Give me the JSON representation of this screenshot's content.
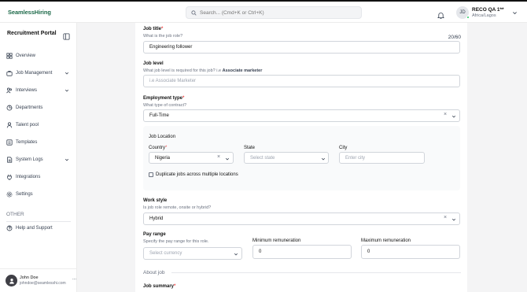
{
  "brand": {
    "logo": "SeamlessHiring"
  },
  "search": {
    "placeholder": "Search... (Cmd+K or Ctrl+K)"
  },
  "user": {
    "initials": "JD",
    "name": "RECO QA 1**",
    "location": "Africa/Lagos"
  },
  "sidebar": {
    "title": "Recruitment Portal",
    "items": [
      {
        "label": "Overview",
        "icon": "grid-icon"
      },
      {
        "label": "Job Management",
        "icon": "briefcase-icon"
      },
      {
        "label": "Interviews",
        "icon": "people-icon"
      },
      {
        "label": "Departments",
        "icon": "building-icon"
      },
      {
        "label": "Talent pool",
        "icon": "users-icon"
      },
      {
        "label": "Templates",
        "icon": "template-icon"
      },
      {
        "label": "System Logs",
        "icon": "log-icon"
      },
      {
        "label": "Integrations",
        "icon": "plug-icon"
      },
      {
        "label": "Settings",
        "icon": "gear-icon"
      }
    ],
    "other_title": "OTHER",
    "other_items": [
      {
        "label": "Help and Support",
        "icon": "help-icon"
      }
    ],
    "footer": {
      "name": "John Doe",
      "email": "johndoe@seamlesshi.com",
      "more": "..."
    }
  },
  "form": {
    "job_title": {
      "label": "Job title",
      "hint": "What is the job role?",
      "value": "Engineering follower",
      "counter": "20/60"
    },
    "job_level": {
      "label": "Job level",
      "hint_prefix": "What job level is required for this job? i.e",
      "hint_bold": "Associate marketer",
      "placeholder": "i.e Associate Marketer"
    },
    "employment_type": {
      "label": "Employment type",
      "hint": "What type of contract?",
      "value": "Full-Time"
    },
    "job_location": {
      "label": "Job Location",
      "country": {
        "label": "Country",
        "value": "Nigeria"
      },
      "state": {
        "label": "State",
        "placeholder": "Select state"
      },
      "city": {
        "label": "City",
        "placeholder": "Enter city"
      },
      "duplicate_label": "Duplicate jobs across multiple locations"
    },
    "work_style": {
      "label": "Work style",
      "hint": "Is job role remote, onsite or hybrid?",
      "value": "Hybrid"
    },
    "pay_range": {
      "label": "Pay range",
      "hint": "Specify the pay range for this role.",
      "currency_placeholder": "Select currency",
      "min_label": "Minimum remuneration",
      "min_value": "0",
      "max_label": "Maximum remuneration",
      "max_value": "0"
    },
    "about_job": "About job",
    "job_summary": {
      "label": "Job summary"
    }
  }
}
